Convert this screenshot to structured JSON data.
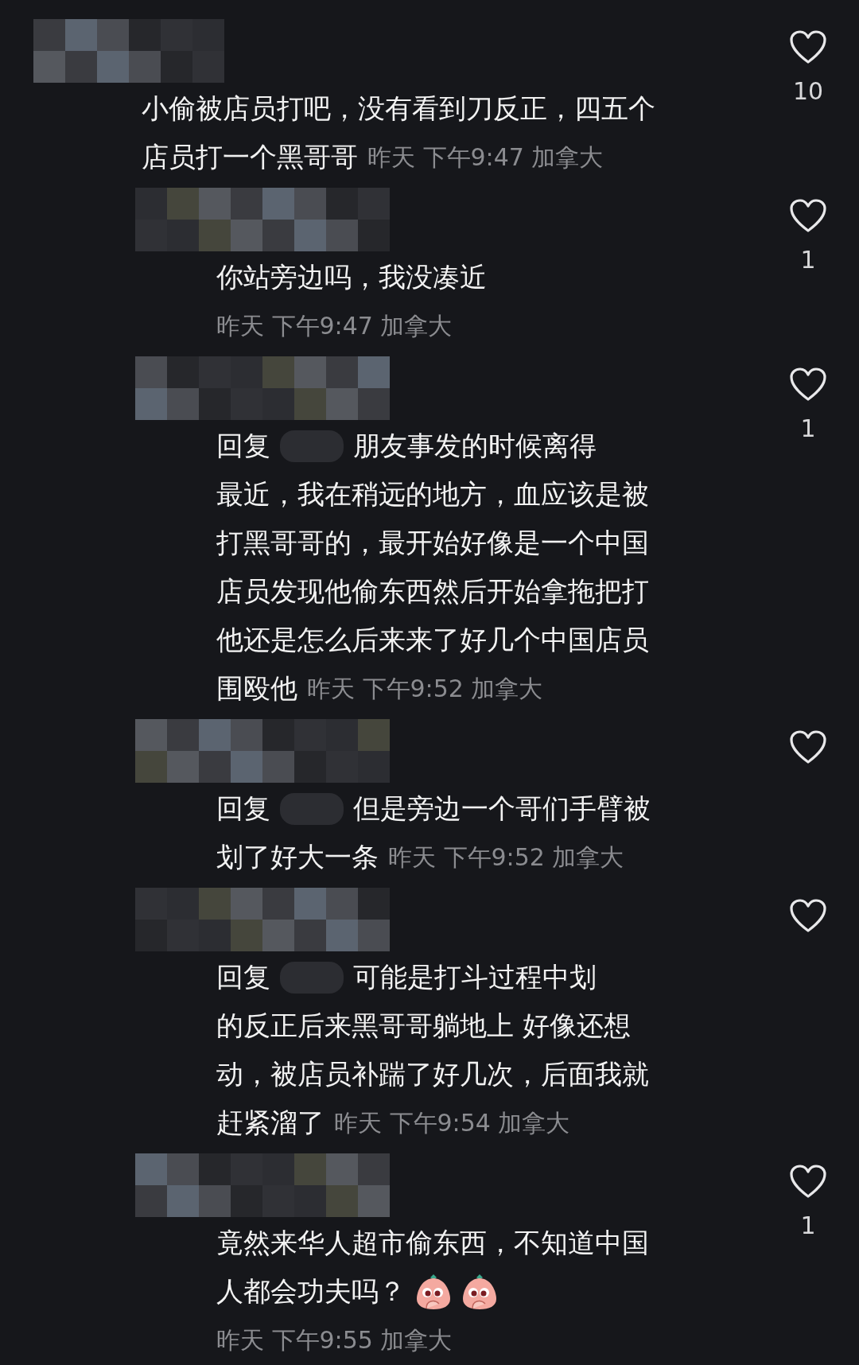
{
  "comments": [
    {
      "kind": "comment",
      "lines": [
        "小偷被店员打吧，没有看到刀反正，四五个",
        "店员打一个黑哥哥"
      ],
      "time": "昨天 下午9:47 加拿大",
      "likes": "10"
    },
    {
      "kind": "reply",
      "lines": [
        "你站旁边吗，我没凑近"
      ],
      "time": "昨天 下午9:47 加拿大",
      "likes": "1"
    },
    {
      "kind": "reply",
      "prefix": "回复",
      "lines": [
        "朋友事发的时候离得",
        "最近，我在稍远的地方，血应该是被",
        "打黑哥哥的，最开始好像是一个中国",
        "店员发现他偷东西然后开始拿拖把打",
        "他还是怎么后来来了好几个中国店员",
        "围殴他"
      ],
      "time": "昨天 下午9:52 加拿大",
      "likes": "1"
    },
    {
      "kind": "reply",
      "prefix": "回复",
      "lines": [
        "但是旁边一个哥们手臂被",
        "划了好大一条"
      ],
      "time": "昨天 下午9:52 加拿大"
    },
    {
      "kind": "reply",
      "prefix": "回复",
      "lines": [
        "可能是打斗过程中划",
        "的反正后来黑哥哥躺地上 好像还想",
        "动，被店员补踹了好几次，后面我就",
        "赶紧溜了"
      ],
      "time": "昨天 下午9:54 加拿大"
    },
    {
      "kind": "reply",
      "lines": [
        "竟然来华人超市偷东西，不知道中国",
        "人都会功夫吗？"
      ],
      "emojis": [
        {
          "kind": "peach"
        },
        {
          "kind": "peach"
        }
      ],
      "time": "昨天 下午9:55 加拿大",
      "likes": "1"
    }
  ]
}
